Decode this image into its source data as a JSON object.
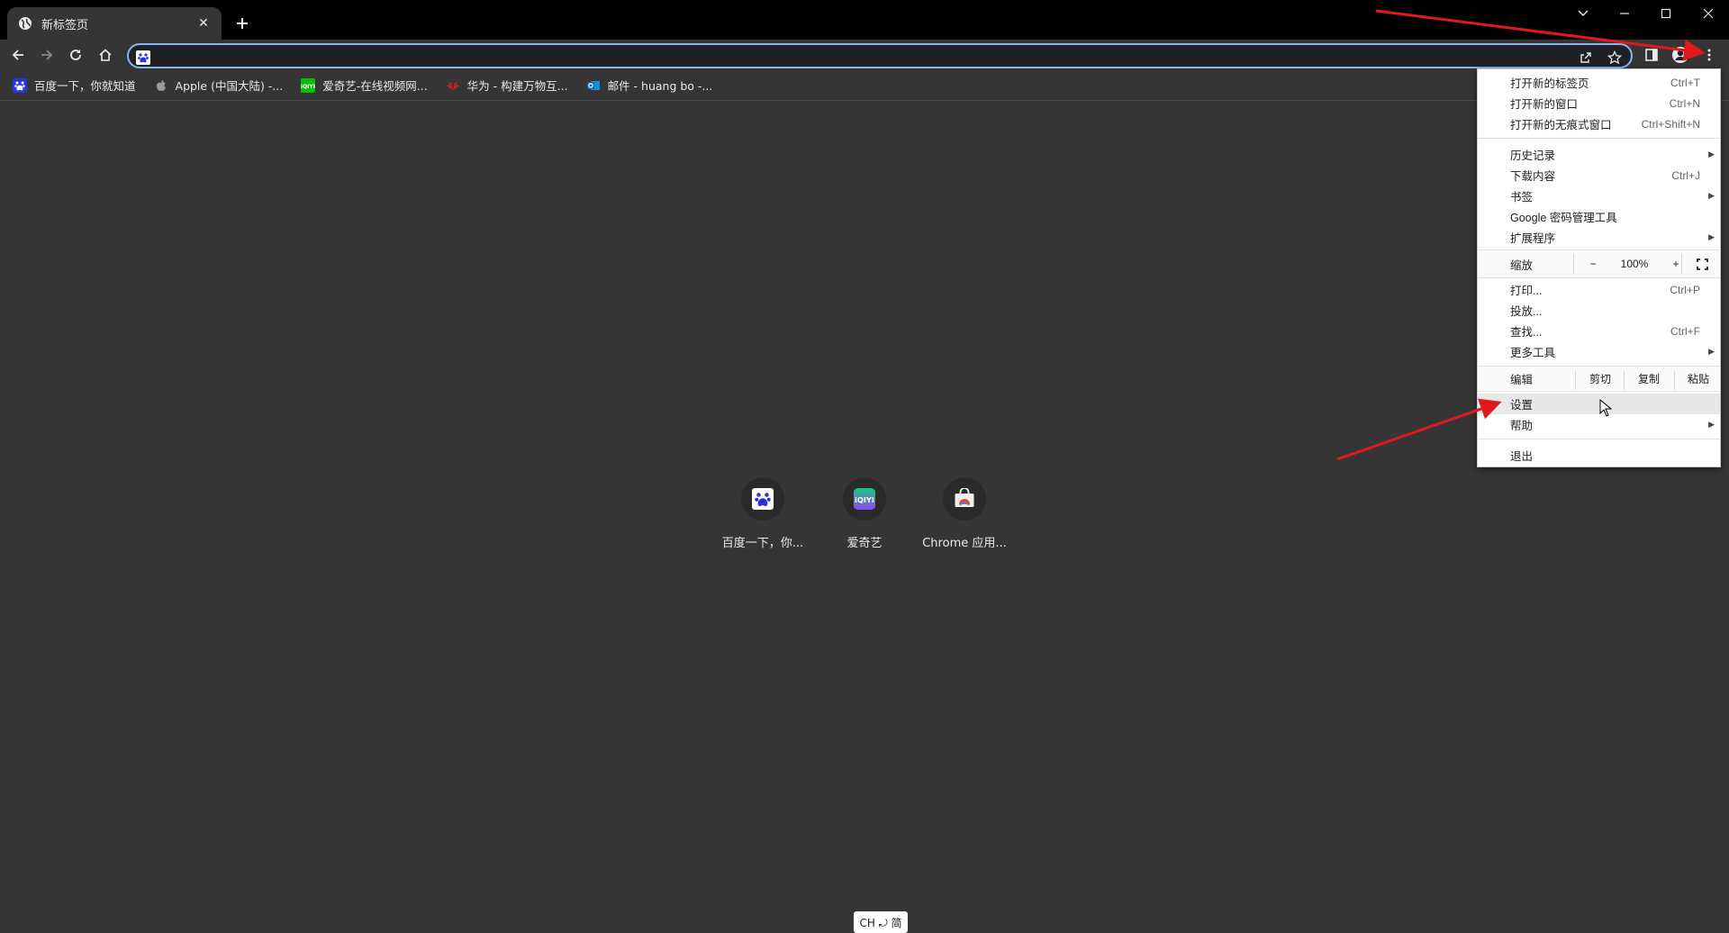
{
  "tab": {
    "title": "新标签页"
  },
  "window": {
    "controls": [
      "minimize-icon",
      "maximize-icon",
      "close-icon"
    ]
  },
  "omnibox": {
    "value": "",
    "placeholder": ""
  },
  "bookmarks": [
    {
      "label": "百度一下，你就知道",
      "icon": "baidu-icon"
    },
    {
      "label": "Apple (中国大陆) -...",
      "icon": "apple-icon"
    },
    {
      "label": "爱奇艺-在线视频网...",
      "icon": "iqiyi-icon"
    },
    {
      "label": "华为 - 构建万物互...",
      "icon": "huawei-icon"
    },
    {
      "label": "邮件 - huang bo -...",
      "icon": "outlook-icon"
    }
  ],
  "shortcuts": [
    {
      "label": "百度一下，你...",
      "icon": "baidu-icon"
    },
    {
      "label": "爱奇艺",
      "icon": "iqiyi-icon"
    },
    {
      "label": "Chrome 应用...",
      "icon": "chrome-webstore-icon"
    }
  ],
  "ime": {
    "label": "CH ⤾ 简"
  },
  "menu": {
    "new_tab": {
      "label": "打开新的标签页",
      "shortcut": "Ctrl+T"
    },
    "new_window": {
      "label": "打开新的窗口",
      "shortcut": "Ctrl+N"
    },
    "incognito": {
      "label": "打开新的无痕式窗口",
      "shortcut": "Ctrl+Shift+N"
    },
    "history": {
      "label": "历史记录"
    },
    "downloads": {
      "label": "下载内容",
      "shortcut": "Ctrl+J"
    },
    "bookmarks": {
      "label": "书签"
    },
    "passwords": {
      "label": "Google 密码管理工具"
    },
    "extensions": {
      "label": "扩展程序"
    },
    "zoom": {
      "label": "缩放",
      "minus": "−",
      "value": "100%",
      "plus": "+"
    },
    "print": {
      "label": "打印...",
      "shortcut": "Ctrl+P"
    },
    "cast": {
      "label": "投放..."
    },
    "find": {
      "label": "查找...",
      "shortcut": "Ctrl+F"
    },
    "more_tools": {
      "label": "更多工具"
    },
    "edit": {
      "label": "编辑",
      "cut": "剪切",
      "copy": "复制",
      "paste": "粘贴"
    },
    "settings": {
      "label": "设置"
    },
    "help": {
      "label": "帮助"
    },
    "exit": {
      "label": "退出"
    }
  },
  "colors": {
    "accent": "#8ab4f8",
    "annotation_arrow": "#e0191a",
    "background": "#353535"
  }
}
